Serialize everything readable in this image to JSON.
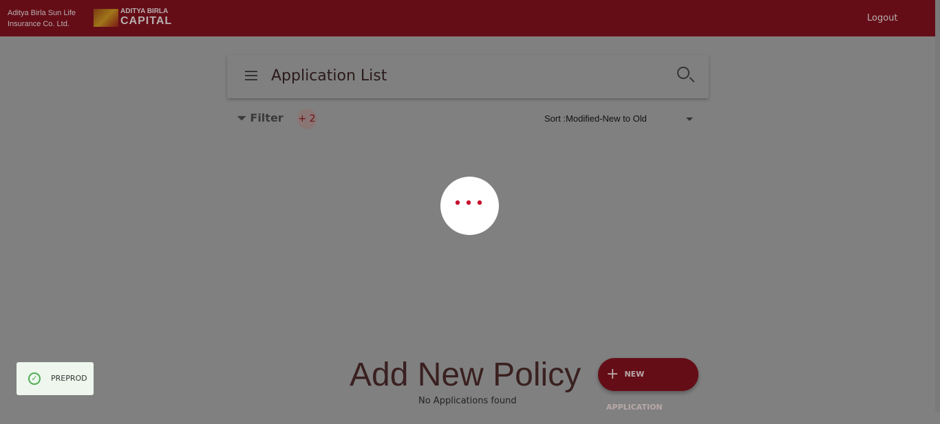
{
  "header": {
    "brand_line1": "Aditya Birla Sun Life",
    "brand_line2": "Insurance Co. Ltd.",
    "logo_top": "ADITYA BIRLA",
    "logo_bottom": "CAPITAL",
    "logout": "Logout"
  },
  "card": {
    "title": "Application List"
  },
  "filter": {
    "label": "Filter",
    "badge": "+ 2"
  },
  "sort": {
    "label": "Sort :",
    "value": "Modified-New to Old"
  },
  "loader": {
    "dots": "•••"
  },
  "main": {
    "heading": "Add New Policy",
    "empty": "No Applications found",
    "new_button": "NEW APPLICATION",
    "plus": "+"
  },
  "env": {
    "label": "PREPROD",
    "check": "✓"
  }
}
